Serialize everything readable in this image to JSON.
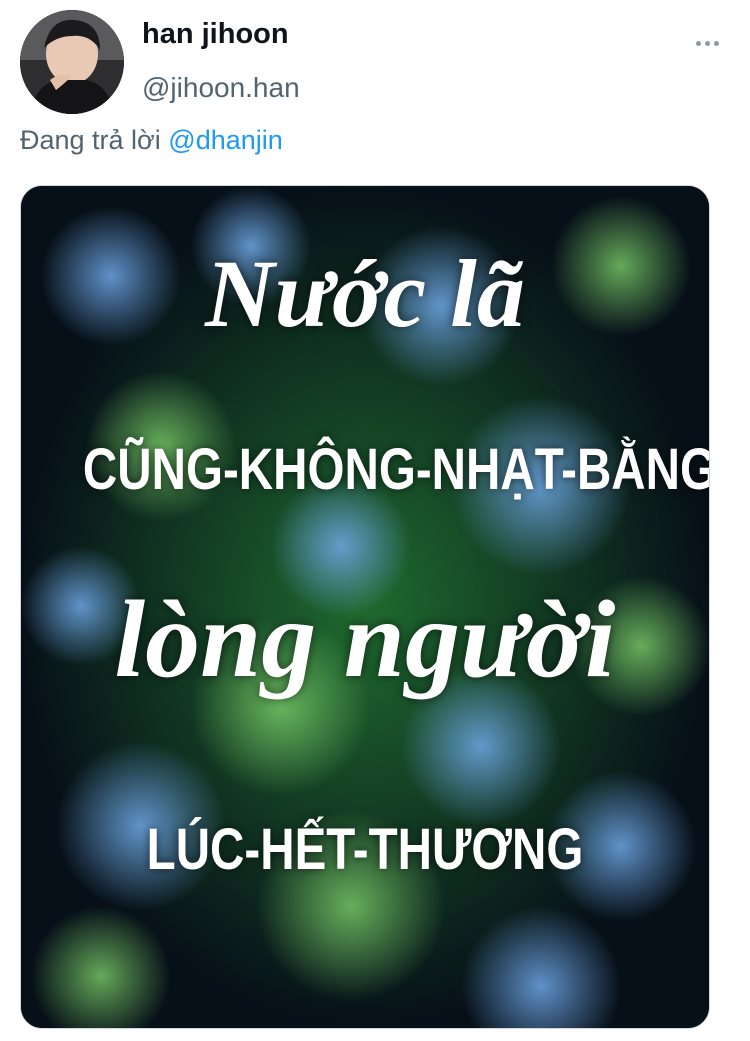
{
  "author": {
    "name": "han jihoon",
    "handle": "@jihoon.han"
  },
  "reply": {
    "prefix": "Đang trả lời",
    "mention": "@dhanjin"
  },
  "media": {
    "lines": [
      "Nước lã",
      "CŨNG-KHÔNG-NHẠT-BẰNG",
      "lòng người",
      "LÚC-HẾT-THƯƠNG"
    ]
  },
  "icons": {
    "more": "more-options-icon"
  },
  "colors": {
    "accent": "#1d9bf0",
    "secondary_text": "#536471"
  }
}
